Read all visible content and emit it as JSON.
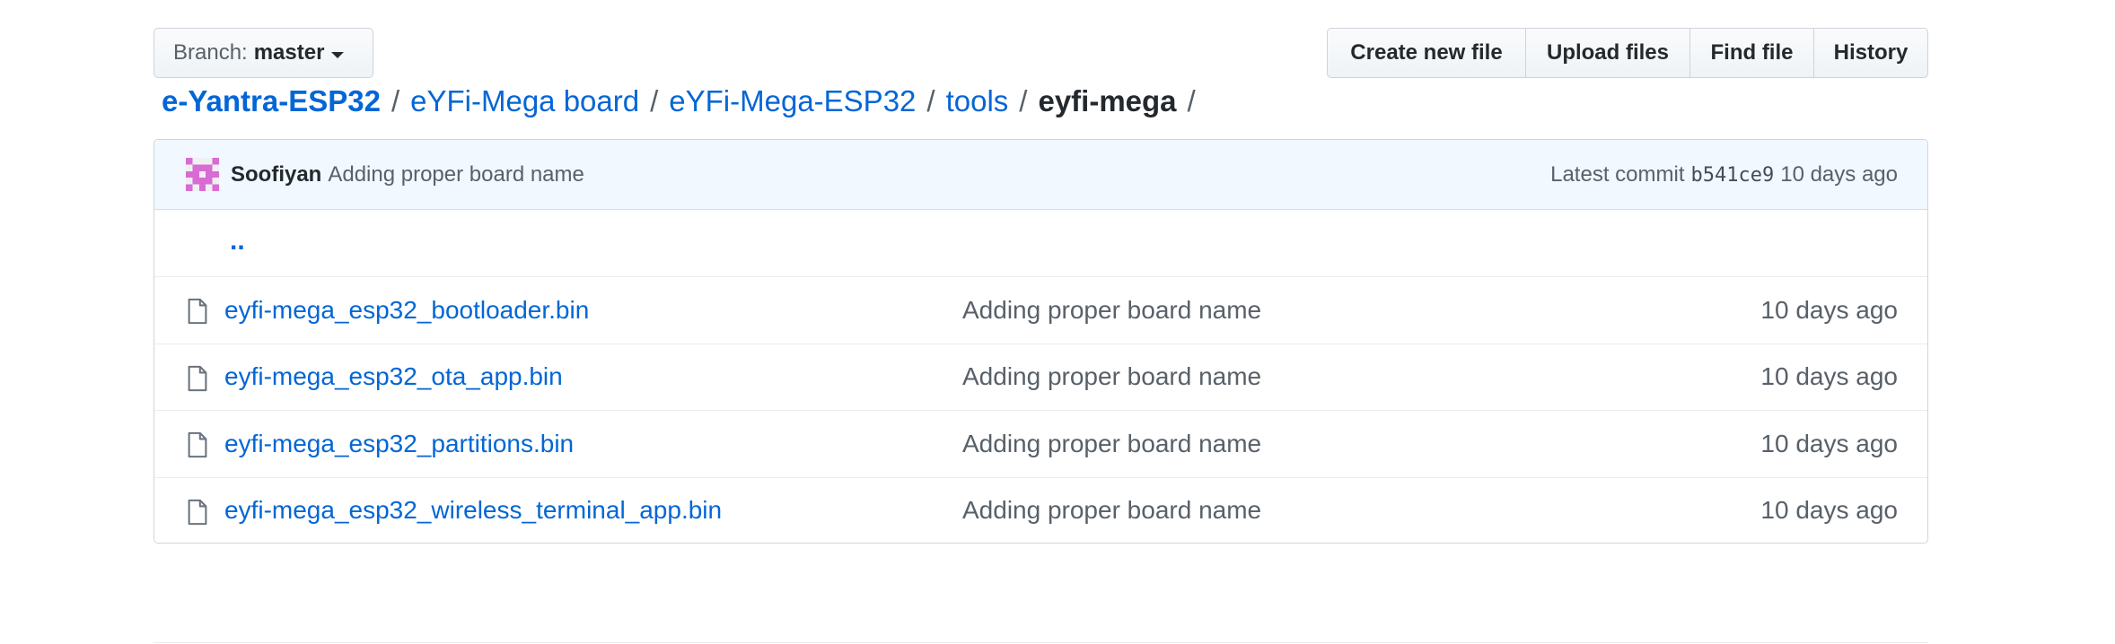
{
  "branch": {
    "label": "Branch:",
    "value": "master"
  },
  "actions": {
    "create": "Create new file",
    "upload": "Upload files",
    "find": "Find file",
    "history": "History"
  },
  "breadcrumb": {
    "root": "e-Yantra-ESP32",
    "parts": [
      "eYFi-Mega board",
      "eYFi-Mega-ESP32",
      "tools"
    ],
    "current": "eyfi-mega",
    "separator": "/"
  },
  "commit": {
    "author": "Soofiyan",
    "message": "Adding proper board name",
    "latest_label": "Latest commit",
    "sha": "b541ce9",
    "age": "10 days ago"
  },
  "parent_dir": "..",
  "files": [
    {
      "name": "eyfi-mega_esp32_bootloader.bin",
      "message": "Adding proper board name",
      "age": "10 days ago"
    },
    {
      "name": "eyfi-mega_esp32_ota_app.bin",
      "message": "Adding proper board name",
      "age": "10 days ago"
    },
    {
      "name": "eyfi-mega_esp32_partitions.bin",
      "message": "Adding proper board name",
      "age": "10 days ago"
    },
    {
      "name": "eyfi-mega_esp32_wireless_terminal_app.bin",
      "message": "Adding proper board name",
      "age": "10 days ago"
    }
  ],
  "colors": {
    "link": "#0366d6",
    "muted": "#586069",
    "commit_bg": "#f1f8ff",
    "avatar": "#d86bd4"
  },
  "icons": {
    "branch_caret": "caret-down-icon",
    "file": "file-icon",
    "avatar": "identicon-avatar"
  }
}
